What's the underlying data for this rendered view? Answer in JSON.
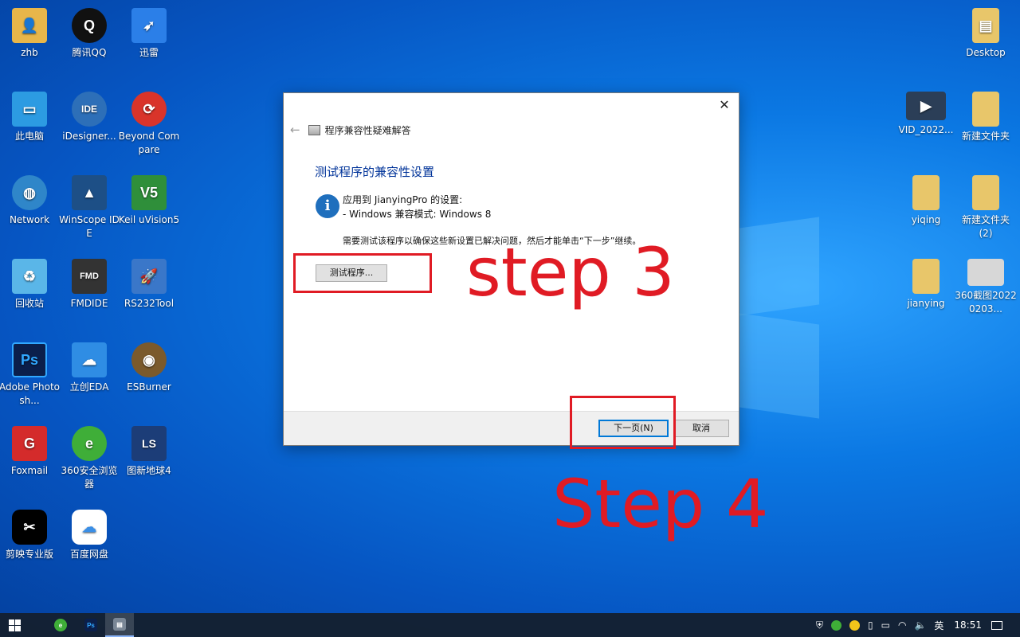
{
  "desktop": {
    "icons": [
      {
        "label": "zhb",
        "color": "#e8b64a"
      },
      {
        "label": "腾讯QQ",
        "color": "#111111"
      },
      {
        "label": "迅雷",
        "color": "#2b7fe8"
      },
      {
        "label": "此电脑",
        "color": "#2c9be2"
      },
      {
        "label": "iDesigner...",
        "color": "#2d6fb8"
      },
      {
        "label": "Beyond Compare",
        "color": "#d9342a"
      },
      {
        "label": "Network",
        "color": "#2f86c9"
      },
      {
        "label": "WinScope IDE",
        "color": "#1d4f86"
      },
      {
        "label": "Keil uVision5",
        "color": "#2f8f3a"
      },
      {
        "label": "回收站",
        "color": "#5ab6e8"
      },
      {
        "label": "FMDIDE",
        "color": "#333333"
      },
      {
        "label": "RS232Tool",
        "color": "#3a77c9"
      },
      {
        "label": "Adobe Photosh...",
        "color": "#0b1f4b"
      },
      {
        "label": "立创EDA",
        "color": "#2f8de4"
      },
      {
        "label": "ESBurner",
        "color": "#7b5a2c"
      },
      {
        "label": "Foxmail",
        "color": "#d42b2b"
      },
      {
        "label": "360安全浏览器",
        "color": "#3fae38"
      },
      {
        "label": "图新地球4",
        "color": "#1c3d78"
      },
      {
        "label": "剪映专业版",
        "color": "#000000"
      },
      {
        "label": "百度网盘",
        "color": "#3a8ee6"
      },
      {
        "label": "Desktop",
        "color": "#e8c66a"
      },
      {
        "label": "VID_2022...",
        "color": "#2b3e57"
      },
      {
        "label": "新建文件夹",
        "color": "#e8c66a"
      },
      {
        "label": "yiqing",
        "color": "#e8c66a"
      },
      {
        "label": "新建文件夹 (2)",
        "color": "#e8c66a"
      },
      {
        "label": "jianying",
        "color": "#e8c66a"
      },
      {
        "label": "360截图20220203...",
        "color": "#d7d7d7"
      }
    ]
  },
  "dialog": {
    "nav_title": "程序兼容性疑难解答",
    "heading": "测试程序的兼容性设置",
    "apply_line": "应用到 JianyingPro 的设置:",
    "mode_line": "- Windows 兼容模式: Windows 8",
    "description": "需要测试该程序以确保这些新设置已解决问题，然后才能单击“下一步”继续。",
    "test_button": "测试程序...",
    "next_button": "下一页(N)",
    "cancel_button": "取消",
    "close_symbol": "✕",
    "back_symbol": "←"
  },
  "annotations": {
    "step3": "step 3",
    "step4": "Step 4",
    "color": "#e01b24"
  },
  "taskbar": {
    "apps": [
      {
        "label": "e",
        "color": "#3fae38"
      },
      {
        "label": "Ps",
        "color": "#0b1f4b"
      },
      {
        "label": "▤",
        "color": "#7a8796"
      }
    ],
    "tray": {
      "ime": "英",
      "time": "18:51"
    }
  }
}
